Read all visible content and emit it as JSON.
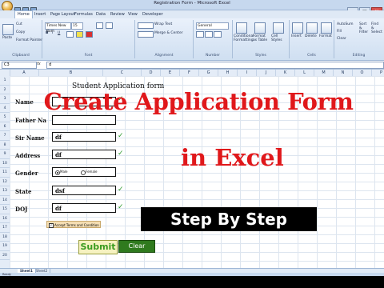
{
  "window": {
    "title": "Registration Form - Microsoft Excel"
  },
  "tabs": [
    "Home",
    "Insert",
    "Page Layout",
    "Formulas",
    "Data",
    "Review",
    "View",
    "Developer"
  ],
  "ribbon": {
    "clipboard": {
      "paste": "Paste",
      "cut": "Cut",
      "copy": "Copy",
      "format_painter": "Format Painter",
      "name": "Clipboard"
    },
    "font": {
      "family": "Times New Rom",
      "size": "15",
      "name": "Font"
    },
    "alignment": {
      "wrap": "Wrap Text",
      "merge": "Merge & Center",
      "name": "Alignment"
    },
    "number": {
      "format": "General",
      "name": "Number"
    },
    "styles": {
      "conditional": "Conditional Formatting",
      "format_table": "Format as Table",
      "cell_styles": "Cell Styles",
      "name": "Styles"
    },
    "cells": {
      "insert": "Insert",
      "delete": "Delete",
      "format": "Format",
      "name": "Cells"
    },
    "editing": {
      "autosum": "AutoSum",
      "fill": "Fill",
      "clear": "Clear",
      "sort": "Sort & Filter",
      "find": "Find & Select",
      "name": "Editing"
    }
  },
  "formula_bar": {
    "cell": "C3",
    "value": "d"
  },
  "columns": [
    "A",
    "B",
    "C",
    "D",
    "E",
    "F",
    "G",
    "H",
    "I",
    "J",
    "K",
    "L",
    "M",
    "N",
    "O",
    "P"
  ],
  "rows": [
    "1",
    "2",
    "3",
    "4",
    "5",
    "6",
    "7",
    "8",
    "9",
    "10",
    "11",
    "12",
    "13",
    "14",
    "15",
    "16",
    "17",
    "18",
    "19",
    "20"
  ],
  "form": {
    "title": "Student  Application form",
    "fields": [
      {
        "label": "Name",
        "value": ""
      },
      {
        "label": "Father Na",
        "value": ""
      },
      {
        "label": "Sir Name",
        "value": "df"
      },
      {
        "label": "Address",
        "value": "df"
      },
      {
        "label": "Gender",
        "value": ""
      },
      {
        "label": "State",
        "value": "dsf"
      },
      {
        "label": "DOJ",
        "value": "df"
      }
    ],
    "gender_options": [
      "Male",
      "Female"
    ],
    "gender_selected": "Male",
    "terms": "Accept Terms and Condition",
    "submit": "Submit",
    "clear": "Clear"
  },
  "overlay": {
    "line1": "Create Application Form",
    "line2": "in Excel",
    "badge": "Step By Step"
  },
  "sheets": [
    "Sheet1",
    "Sheet2"
  ],
  "status": "Ready",
  "colors": {
    "overlay_red": "#e0181b",
    "check_green": "#2e9a2e",
    "clear_green": "#2f7a1e"
  }
}
